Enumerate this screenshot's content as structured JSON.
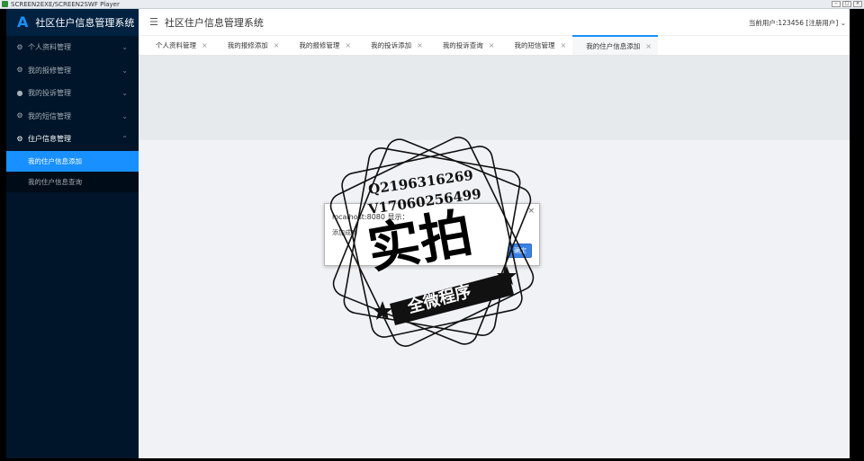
{
  "player": {
    "title": "SCREEN2EXE/SCREEN2SWF Player"
  },
  "sidebar": {
    "brand_logo": "A",
    "brand_title": "社区住户信息管理系统",
    "items": [
      {
        "label": "个人资料管理",
        "icon": "gear-icon",
        "open": false
      },
      {
        "label": "我的报修管理",
        "icon": "gear-icon",
        "open": false
      },
      {
        "label": "我的投诉管理",
        "icon": "user-icon",
        "open": false
      },
      {
        "label": "我的短信管理",
        "icon": "gear-icon",
        "open": false
      },
      {
        "label": "住户信息管理",
        "icon": "gear-icon",
        "open": true
      }
    ],
    "subitems": [
      {
        "label": "我的住户信息添加",
        "active": true
      },
      {
        "label": "我的住户信息查询",
        "active": false
      }
    ]
  },
  "header": {
    "title": "社区住户信息管理系统",
    "user_text": "当前用户:123456 [注册用户]"
  },
  "tabs": [
    {
      "label": "个人资料管理",
      "active": false
    },
    {
      "label": "我的报修添加",
      "active": false
    },
    {
      "label": "我的报修管理",
      "active": false
    },
    {
      "label": "我的投诉添加",
      "active": false
    },
    {
      "label": "我的投诉查询",
      "active": false
    },
    {
      "label": "我的短信管理",
      "active": false
    },
    {
      "label": "我的住户信息添加",
      "active": true
    }
  ],
  "dialog": {
    "title": "localhost:8080 显示：",
    "message": "添加成功",
    "ok_label": "确定"
  },
  "watermark": {
    "line1": "Q2196316269",
    "line2": "V17060256499",
    "big_text": "实拍",
    "ribbon_text": "全微程序"
  },
  "colors": {
    "sidebar_bg": "#001529",
    "accent": "#1890ff",
    "content_bg": "#f0f2f5"
  }
}
